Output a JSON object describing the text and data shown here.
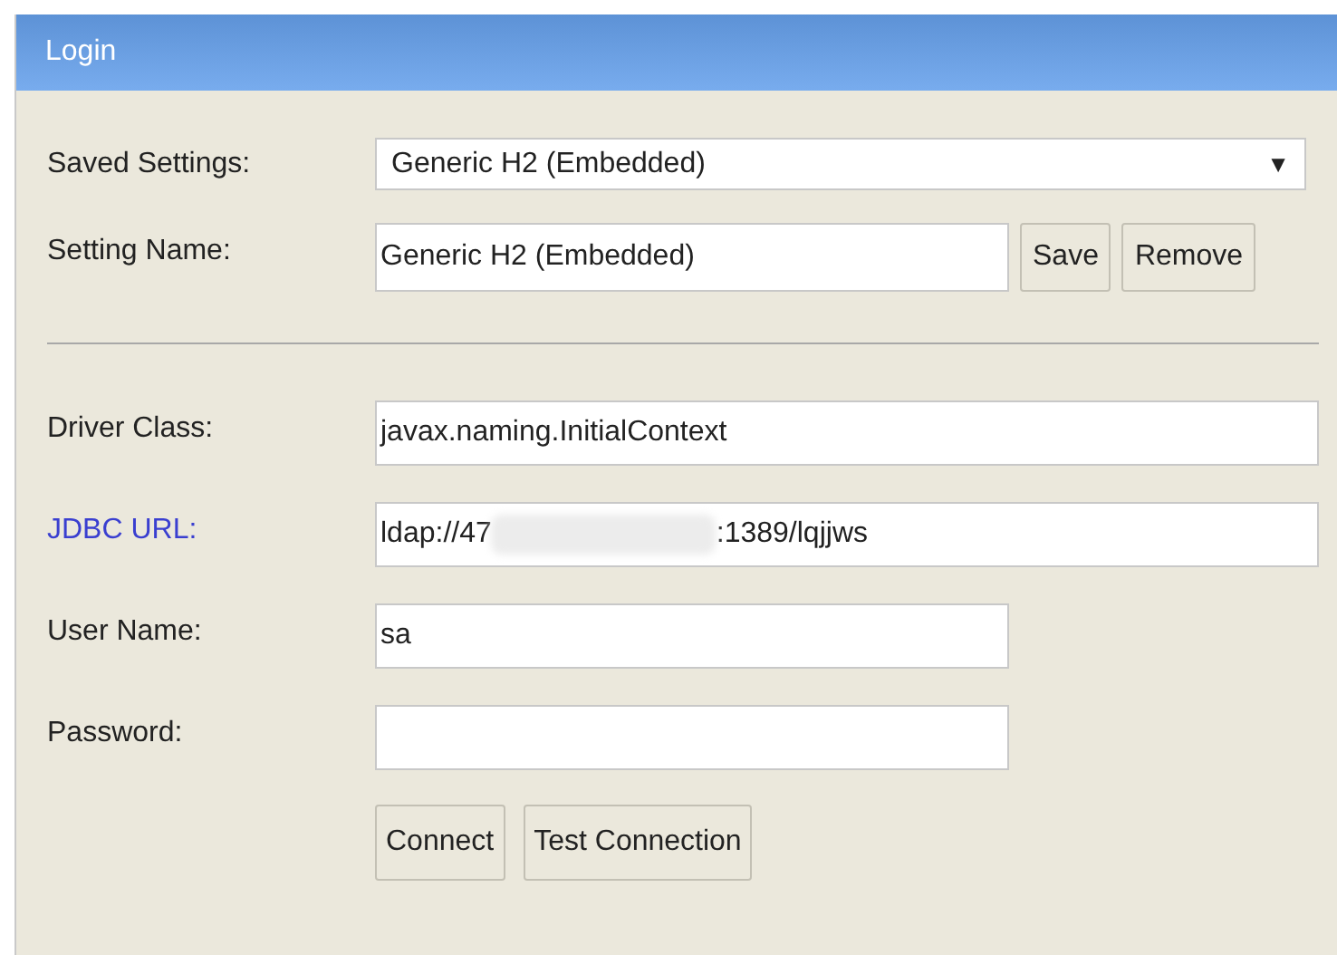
{
  "window": {
    "title": "Login"
  },
  "saved_settings": {
    "label": "Saved Settings:",
    "value": "Generic H2 (Embedded)",
    "arrow": "▼"
  },
  "setting_name": {
    "label": "Setting Name:",
    "value": "Generic H2 (Embedded)",
    "buttons": [
      "Save",
      "Remove"
    ]
  },
  "fields": [
    {
      "label": "Driver Class:",
      "linked": false,
      "kind": "wide",
      "value": "javax.naming.InitialContext"
    },
    {
      "label": "JDBC URL:",
      "linked": true,
      "kind": "redacted",
      "value_start": "ldap://47",
      "value_end": ":1389/lqjjws"
    },
    {
      "label": "User Name:",
      "linked": false,
      "kind": "short",
      "value": "sa"
    },
    {
      "label": "Password:",
      "linked": false,
      "kind": "short"
    }
  ],
  "buttons": [
    "Connect",
    "Test Connection"
  ]
}
